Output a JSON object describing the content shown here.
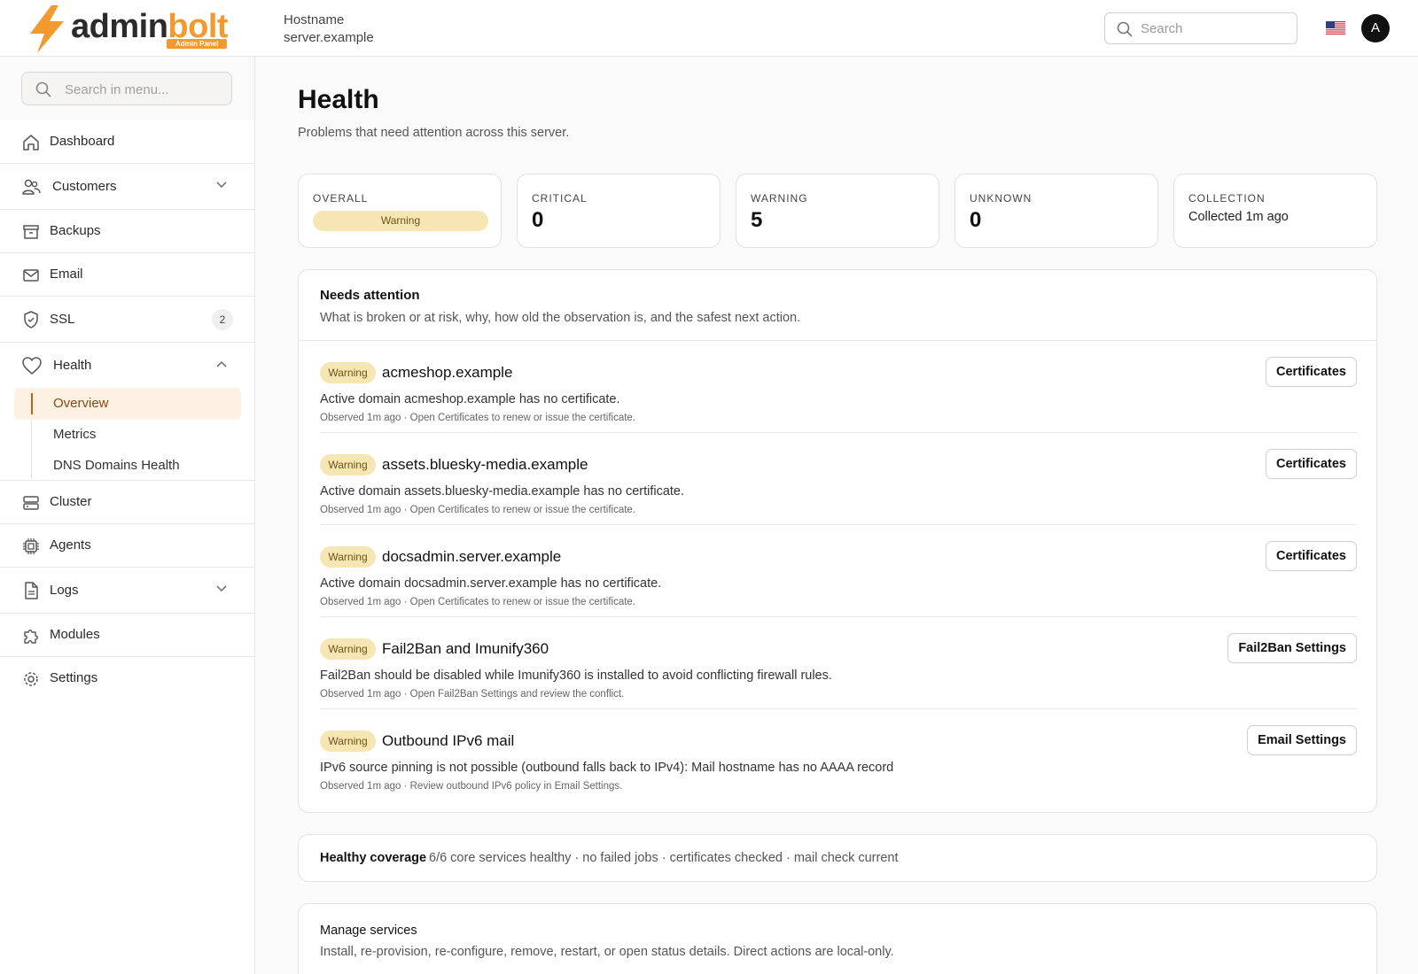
{
  "brand": {
    "name_part1": "admin",
    "name_part2": "bolt",
    "badge": "Admin Panel",
    "accent_color": "#f29a2e"
  },
  "header": {
    "hostname_label": "Hostname",
    "hostname_value": "server.example",
    "search_placeholder": "Search",
    "language_flag": "us-flag-icon",
    "avatar_initial": "A"
  },
  "sidebar": {
    "search_placeholder": "Search in menu...",
    "items": [
      {
        "label": "Dashboard",
        "icon": "home-icon"
      },
      {
        "label": "Customers",
        "icon": "users-icon",
        "expandable": true
      },
      {
        "label": "Backups",
        "icon": "archive-icon"
      },
      {
        "label": "Email",
        "icon": "mail-icon"
      },
      {
        "label": "SSL",
        "icon": "shield-icon",
        "badge": "2"
      },
      {
        "label": "Health",
        "icon": "heart-icon",
        "expanded": true,
        "children": [
          {
            "label": "Overview",
            "active": true
          },
          {
            "label": "Metrics"
          },
          {
            "label": "DNS Domains Health"
          }
        ]
      },
      {
        "label": "Cluster",
        "icon": "server-icon"
      },
      {
        "label": "Agents",
        "icon": "cpu-icon"
      },
      {
        "label": "Logs",
        "icon": "file-text-icon",
        "expandable": true
      },
      {
        "label": "Modules",
        "icon": "puzzle-icon"
      },
      {
        "label": "Settings",
        "icon": "gear-icon"
      }
    ]
  },
  "page": {
    "title": "Health",
    "subtitle": "Problems that need attention across this server."
  },
  "summary": {
    "overall_label": "OVERALL",
    "overall_status": "Warning",
    "critical_label": "CRITICAL",
    "critical_value": "0",
    "warning_label": "WARNING",
    "warning_value": "5",
    "unknown_label": "UNKNOWN",
    "unknown_value": "0",
    "collection_label": "COLLECTION",
    "collection_value": "Collected 1m ago",
    "warning_color": "#f6e6b3"
  },
  "attention": {
    "title": "Needs attention",
    "subtitle": "What is broken or at risk, why, how old the observation is, and the safest next action.",
    "issues": [
      {
        "severity": "Warning",
        "title": "acmeshop.example",
        "description": "Active domain acmeshop.example has no certificate.",
        "meta": "Observed 1m ago · Open Certificates to renew or issue the certificate.",
        "action": "Certificates"
      },
      {
        "severity": "Warning",
        "title": "assets.bluesky-media.example",
        "description": "Active domain assets.bluesky-media.example has no certificate.",
        "meta": "Observed 1m ago · Open Certificates to renew or issue the certificate.",
        "action": "Certificates"
      },
      {
        "severity": "Warning",
        "title": "docsadmin.server.example",
        "description": "Active domain docsadmin.server.example has no certificate.",
        "meta": "Observed 1m ago · Open Certificates to renew or issue the certificate.",
        "action": "Certificates"
      },
      {
        "severity": "Warning",
        "title": "Fail2Ban and Imunify360",
        "description": "Fail2Ban should be disabled while Imunify360 is installed to avoid conflicting firewall rules.",
        "meta": "Observed 1m ago · Open Fail2Ban Settings and review the conflict.",
        "action": "Fail2Ban Settings"
      },
      {
        "severity": "Warning",
        "title": "Outbound IPv6 mail",
        "description": "IPv6 source pinning is not possible (outbound falls back to IPv4): Mail hostname has no AAAA record",
        "meta": "Observed 1m ago · Review outbound IPv6 policy in Email Settings.",
        "action": "Email Settings"
      }
    ]
  },
  "coverage": {
    "label": "Healthy coverage",
    "text": "6/6 core services healthy · no failed jobs · certificates checked · mail check current"
  },
  "manage": {
    "title": "Manage services",
    "subtitle": "Install, re-provision, re-configure, remove, restart, or open status details. Direct actions are local-only."
  }
}
